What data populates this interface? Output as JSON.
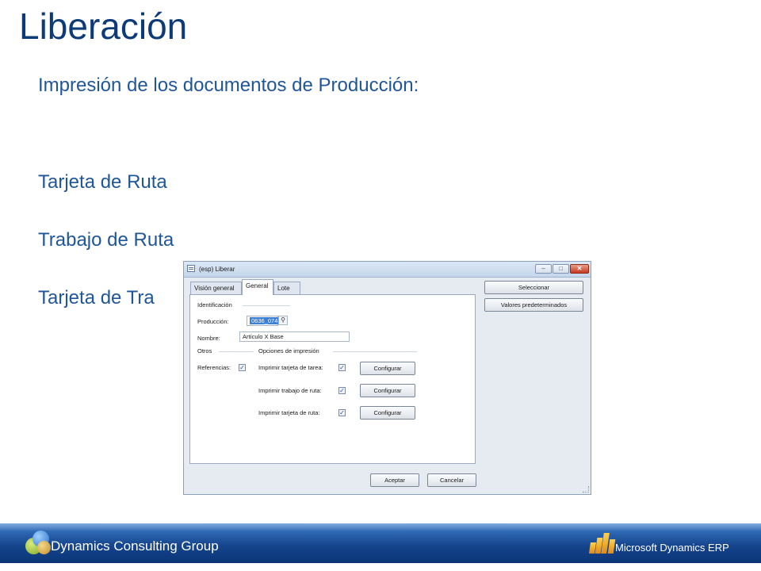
{
  "slide": {
    "title": "Liberación",
    "subtitle": "Impresión de los documentos de Producción:",
    "bullets": [
      "Tarjeta de Ruta",
      "Trabajo de Ruta",
      "Tarjeta de Tra"
    ]
  },
  "dialog": {
    "title": "(esp) Liberar",
    "window_buttons": {
      "minimize": "–",
      "maximize": "□",
      "close": "✕"
    },
    "tabs": [
      {
        "label": "Visión general",
        "active": false
      },
      {
        "label": "General",
        "active": true
      },
      {
        "label": "Lote",
        "active": false
      }
    ],
    "sections": {
      "identificacion": "Identificación",
      "otros": "Otros",
      "opciones": "Opciones de impresión"
    },
    "fields": {
      "produccion_label": "Producción:",
      "produccion_value": "0636_074",
      "nombre_label": "Nombre:",
      "nombre_value": "Artículo X Base",
      "referencias_label": "Referencias:",
      "referencias_checked": true
    },
    "print_options": [
      {
        "label": "Imprimir tarjeta de tarea:",
        "checked": true,
        "button": "Configurar"
      },
      {
        "label": "Imprimir trabajo de ruta:",
        "checked": true,
        "button": "Configurar"
      },
      {
        "label": "Imprimir tarjeta de ruta:",
        "checked": true,
        "button": "Configurar"
      }
    ],
    "side_buttons": {
      "select": "Seleccionar",
      "defaults": "Valores predeterminados"
    },
    "bottom_buttons": {
      "ok": "Aceptar",
      "cancel": "Cancelar"
    },
    "check_mark": "✓",
    "lookup_icon": "magnifier-icon"
  },
  "footer": {
    "company": "Dynamics Consulting Group",
    "brand": "Microsoft Dynamics ERP",
    "colors": {
      "bar": "#15458d",
      "accent": "#3f7fcc"
    }
  }
}
